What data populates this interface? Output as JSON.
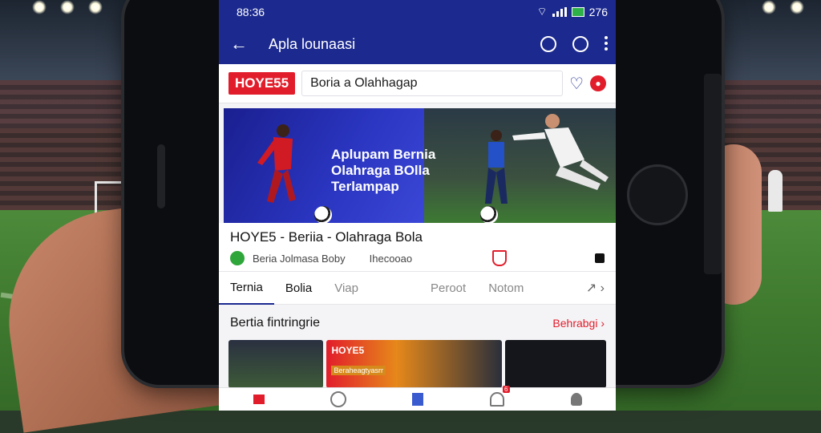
{
  "status_bar": {
    "time": "88:36",
    "battery": "276"
  },
  "app_bar": {
    "title": "Apla lounaasi"
  },
  "search_row": {
    "brand": "HOYE55",
    "query": "Boria a Olahhagap"
  },
  "banner": {
    "headline": "Aplupam Bernia Olahraga BOlla Terlampap"
  },
  "app_info": {
    "title": "HOYE5 - Beriia - Olahraga Bola",
    "developer": "Beria Jolmasa Boby",
    "rating": "Ihecooao"
  },
  "tabs": [
    "Ternia",
    "Bolia",
    "Viap",
    "Peroot",
    "Notom"
  ],
  "section": {
    "title": "Bertia fintringrie",
    "link": "Behrabgi ›"
  },
  "cards": [
    {
      "brand": "",
      "sub": ""
    },
    {
      "brand": "HOYE5",
      "sub": "Beraheagtyasrr"
    },
    {
      "brand": "",
      "sub": ""
    }
  ],
  "nav": {
    "badge": "6"
  },
  "colors": {
    "primary": "#1c2a8f",
    "accent": "#e21d2b",
    "green": "#2fa63a"
  },
  "icons": [
    "back-arrow-icon",
    "chat-icon",
    "search-icon",
    "more-icon",
    "heart-icon",
    "notification-badge-icon",
    "shield-icon",
    "bag-icon",
    "share-icon",
    "home-icon",
    "grid-icon",
    "bookmark-icon",
    "bell-icon",
    "profile-icon"
  ]
}
